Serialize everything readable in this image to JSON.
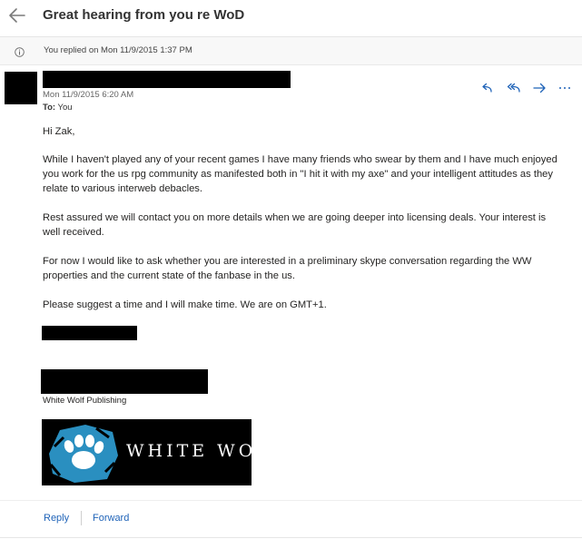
{
  "header": {
    "subject": "Great hearing from you re WoD",
    "back_icon": "back-arrow-icon"
  },
  "replied_bar": {
    "icon": "info-icon",
    "text": "You replied on Mon 11/9/2015 1:37 PM"
  },
  "message": {
    "date": "Mon 11/9/2015 6:20 AM",
    "to_label": "To:",
    "to_value": "You",
    "action_icons": [
      "reply-icon",
      "reply-all-icon",
      "forward-icon",
      "more-icon"
    ],
    "greeting": "Hi Zak,",
    "paragraphs": [
      "While I haven't played any of your recent games I have many friends who swear by them and I have much enjoyed you work for the us rpg community as manifested both in \"I hit it with my axe\" and your intelligent attitudes as they relate to various interweb debacles.",
      "Rest assured we will contact you on more details when we are going deeper into licensing deals. Your interest is well received.",
      "For now I would like to ask whether you are interested in a preliminary skype conversation regarding the WW properties and the current state of the fanbase in the us.",
      "Please suggest a time and I will make time. We are on GMT+1."
    ],
    "signature_company": "White Wolf Publishing",
    "logo_text": "WHITE WOLF"
  },
  "footer": {
    "reply_label": "Reply",
    "forward_label": "Forward"
  },
  "colors": {
    "link": "#1f63b8",
    "logo_accent": "#2a8fc0"
  }
}
